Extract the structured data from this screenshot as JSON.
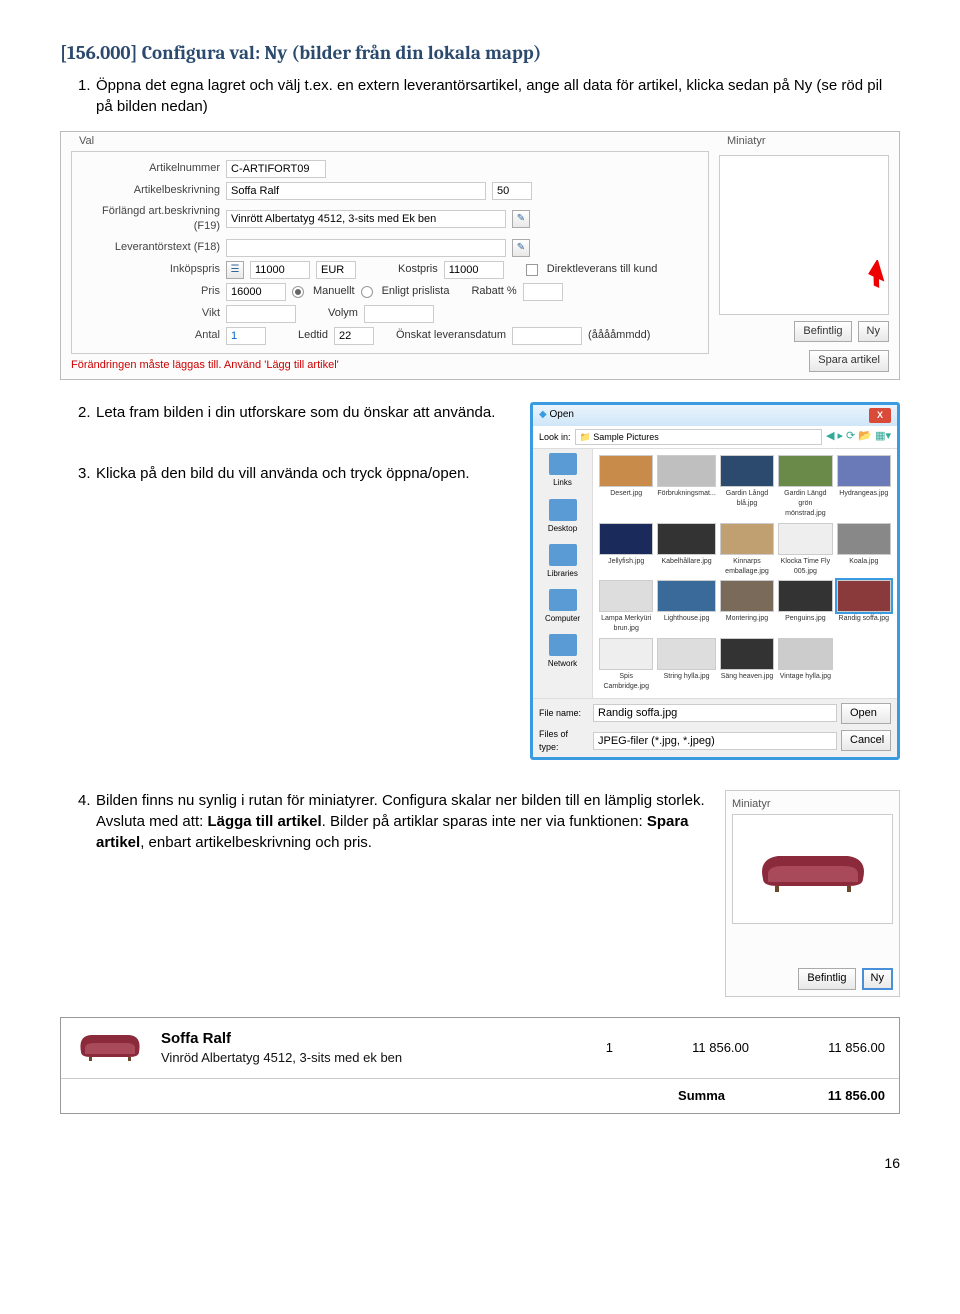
{
  "heading": "[156.000] Configura val: Ny (bilder från din lokala mapp)",
  "p1_num": "1.",
  "p1": "Öppna det egna lagret och välj t.ex. en extern leverantörsartikel, ange all data för artikel, klicka sedan på Ny (se röd pil på bilden nedan)",
  "p2_num": "2.",
  "p2": "Leta fram bilden i din utforskare som du önskar att använda.",
  "p3_num": "3.",
  "p3": "Klicka på den bild du vill använda och tryck öppna/open.",
  "p4_num": "4.",
  "p4a": "Bilden finns nu synlig i rutan för miniatyrer. Configura skalar ner bilden till en lämplig storlek. Avsluta med att: ",
  "p4b": "Lägga till artikel",
  "p4c": ". Bilder på artiklar sparas inte ner via funktionen: ",
  "p4d": "Spara artikel",
  "p4e": ", enbart artikelbeskrivning och pris.",
  "val": {
    "legend": "Val",
    "labels": {
      "artnr": "Artikelnummer",
      "artbesk": "Artikelbeskrivning",
      "forl": "Förlängd art.beskrivning (F19)",
      "lev": "Leverantörstext (F18)",
      "inkop": "Inköpspris",
      "kostpris": "Kostpris",
      "direkt": "Direktleverans till kund",
      "pris": "Pris",
      "manuellt": "Manuellt",
      "enligt": "Enligt prislista",
      "rabatt": "Rabatt %",
      "vikt": "Vikt",
      "volym": "Volym",
      "antal": "Antal",
      "ledtid": "Ledtid",
      "onskat": "Önskat leveransdatum",
      "aaaa": "(ååååmmdd)"
    },
    "values": {
      "artnr": "C-ARTIFORT09",
      "artbesk": "Soffa Ralf",
      "artbesk2": "50",
      "forl": "Vinrött Albertatyg 4512, 3-sits med Ek ben",
      "lev": "",
      "inkop": "11000",
      "cur": "EUR",
      "kostpris": "11000",
      "pris": "16000",
      "antal": "1",
      "ledtid": "22"
    },
    "rednote": "Förändringen måste läggas till. Använd 'Lägg till artikel'",
    "mini_label": "Miniatyr",
    "btn_befintlig": "Befintlig",
    "btn_ny": "Ny",
    "btn_spara": "Spara artikel"
  },
  "open": {
    "title": "Open",
    "lookin": "Look in:",
    "lookin_val": "Sample Pictures",
    "side": [
      "Links",
      "Desktop",
      "Libraries",
      "Computer",
      "Network"
    ],
    "thumbs": [
      {
        "n": "Desert.jpg",
        "c": "#c98b4a"
      },
      {
        "n": "Förbrukningsmat...",
        "c": "#bfbfbf"
      },
      {
        "n": "Gardin Långd blå.jpg",
        "c": "#2b4a6e"
      },
      {
        "n": "Gardin Längd grön mönstrad.jpg",
        "c": "#6a8a4a"
      },
      {
        "n": "Hydrangeas.jpg",
        "c": "#6a7ab8"
      },
      {
        "n": "Jellyfish.jpg",
        "c": "#1a2a5a"
      },
      {
        "n": "Kabelhållare.jpg",
        "c": "#333"
      },
      {
        "n": "Kinnarps emballage.jpg",
        "c": "#c0a070"
      },
      {
        "n": "Klocka Time Fly 005.jpg",
        "c": "#eee"
      },
      {
        "n": "Koala.jpg",
        "c": "#888"
      },
      {
        "n": "Lampa Merkyüri brun.jpg",
        "c": "#ddd"
      },
      {
        "n": "Lighthouse.jpg",
        "c": "#3a6a9a"
      },
      {
        "n": "Montering.jpg",
        "c": "#7a6a5a"
      },
      {
        "n": "Penguins.jpg",
        "c": "#333"
      },
      {
        "n": "Randig soffa.jpg",
        "c": "#8a3a3a",
        "sel": true
      },
      {
        "n": "Spis Cambridge.jpg",
        "c": "#eee"
      },
      {
        "n": "String hylla.jpg",
        "c": "#ddd"
      },
      {
        "n": "Säng heaven.jpg",
        "c": "#333"
      },
      {
        "n": "Vintage hylla.jpg",
        "c": "#ccc"
      }
    ],
    "filename_l": "File name:",
    "filename": "Randig soffa.jpg",
    "filetype_l": "Files of type:",
    "filetype": "JPEG-filer (*.jpg, *.jpeg)",
    "btn_open": "Open",
    "btn_cancel": "Cancel"
  },
  "mini2": {
    "label": "Miniatyr",
    "btn_befintlig": "Befintlig",
    "btn_ny": "Ny"
  },
  "table": {
    "name": "Soffa Ralf",
    "desc": "Vinröd Albertatyg 4512, 3-sits med ek ben",
    "qty": "1",
    "price": "11 856.00",
    "total": "11 856.00",
    "sum_label": "Summa",
    "sum": "11 856.00"
  },
  "pagenum": "16"
}
